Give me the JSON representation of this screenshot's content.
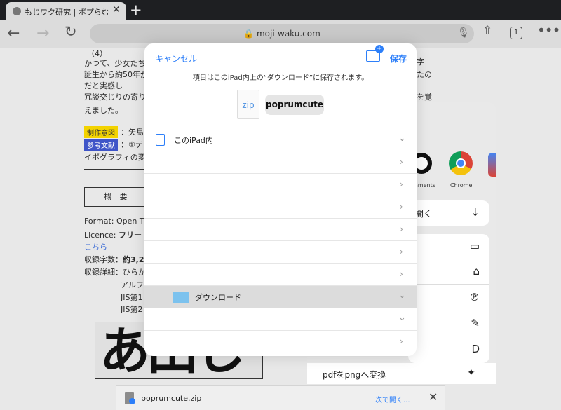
{
  "browser": {
    "tab_title": "もじワク研究 | ポプらむ☆キ",
    "url": "moji-waku.com",
    "tab_count": "1"
  },
  "page": {
    "lines_left": [
      "（4）",
      "かつて、少女たち",
      "誕生から約50年が",
      "だと実感し",
      "冗談交じりの寄り",
      "えました。"
    ],
    "lines_right": [
      "字",
      "たの",
      "を覚"
    ],
    "badge_intent": "制作意図",
    "badge_intent_text": "：矢島",
    "badge_ref": "参考文献",
    "badge_ref_text": "：①テ",
    "ref_line2": "イポグラフィの変",
    "overview": "概　要",
    "format": "Format: Open T",
    "licence_label": "Licence:",
    "licence_value": "フリー",
    "link": "こちら",
    "count_label": "収録字数：",
    "count_value": "約3,2",
    "detail_label": "収録詳細：ひらが",
    "detail_lines": [
      "アルフ",
      "JIS第1",
      "JIS第2"
    ],
    "sample_text": "あ田し"
  },
  "share_sheet": {
    "apps": [
      {
        "label": "mments",
        "icon": "comments-app-icon"
      },
      {
        "label": "Chrome",
        "icon": "chrome-icon"
      }
    ],
    "open_in": "開く",
    "rows": [
      {
        "icon": "folder-icon",
        "glyph": "▭"
      },
      {
        "icon": "tag-icon",
        "glyph": "⌂"
      },
      {
        "icon": "pinterest-icon",
        "glyph": "℗"
      },
      {
        "icon": "markup-icon",
        "glyph": "✎"
      },
      {
        "icon": "d-app-icon",
        "glyph": "D"
      }
    ],
    "pdf_action": "pdfをpngへ変換"
  },
  "dialog": {
    "cancel": "キャンセル",
    "save": "保存",
    "info": "項目はこのiPad内上の“ダウンロード”に保存されます。",
    "file_ext": "zip",
    "file_name": "poprumcute",
    "location_root": "このiPad内",
    "downloads": "ダウンロード"
  },
  "download_bar": {
    "file": "poprumcute.zip",
    "open_with": "次で開く..."
  }
}
